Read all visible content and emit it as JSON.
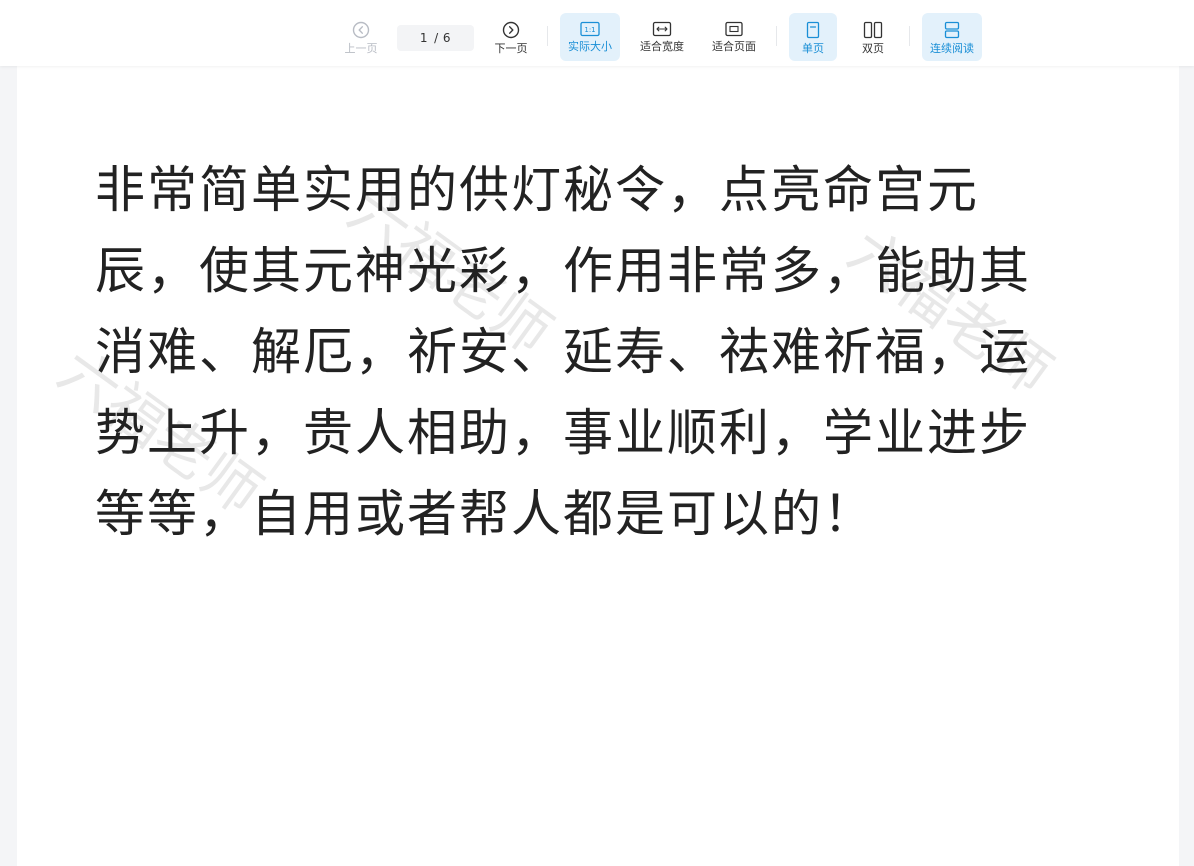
{
  "toolbar": {
    "prev_label": "上一页",
    "next_label": "下一页",
    "current_page": "1",
    "total_pages": "/ 6",
    "actual_size_label": "实际大小",
    "actual_size_icon_text": "1:1",
    "fit_width_label": "适合宽度",
    "fit_page_label": "适合页面",
    "single_page_label": "单页",
    "double_page_label": "双页",
    "continuous_label": "连续阅读"
  },
  "document": {
    "lines": [
      "非常简单实用的供灯秘令，点亮命宫元",
      "辰，使其元神光彩，作用非常多，能助其",
      "消难、解厄，祈安、延寿、祛难祈福，运",
      "势上升，贵人相助，事业顺利，学业进步",
      "等等，自用或者帮人都是可以的！"
    ],
    "watermark_text": "六福老师"
  },
  "colors": {
    "accent": "#1a8fd6",
    "active_bg": "#e3f1fb",
    "disabled": "#b8bcc4"
  }
}
